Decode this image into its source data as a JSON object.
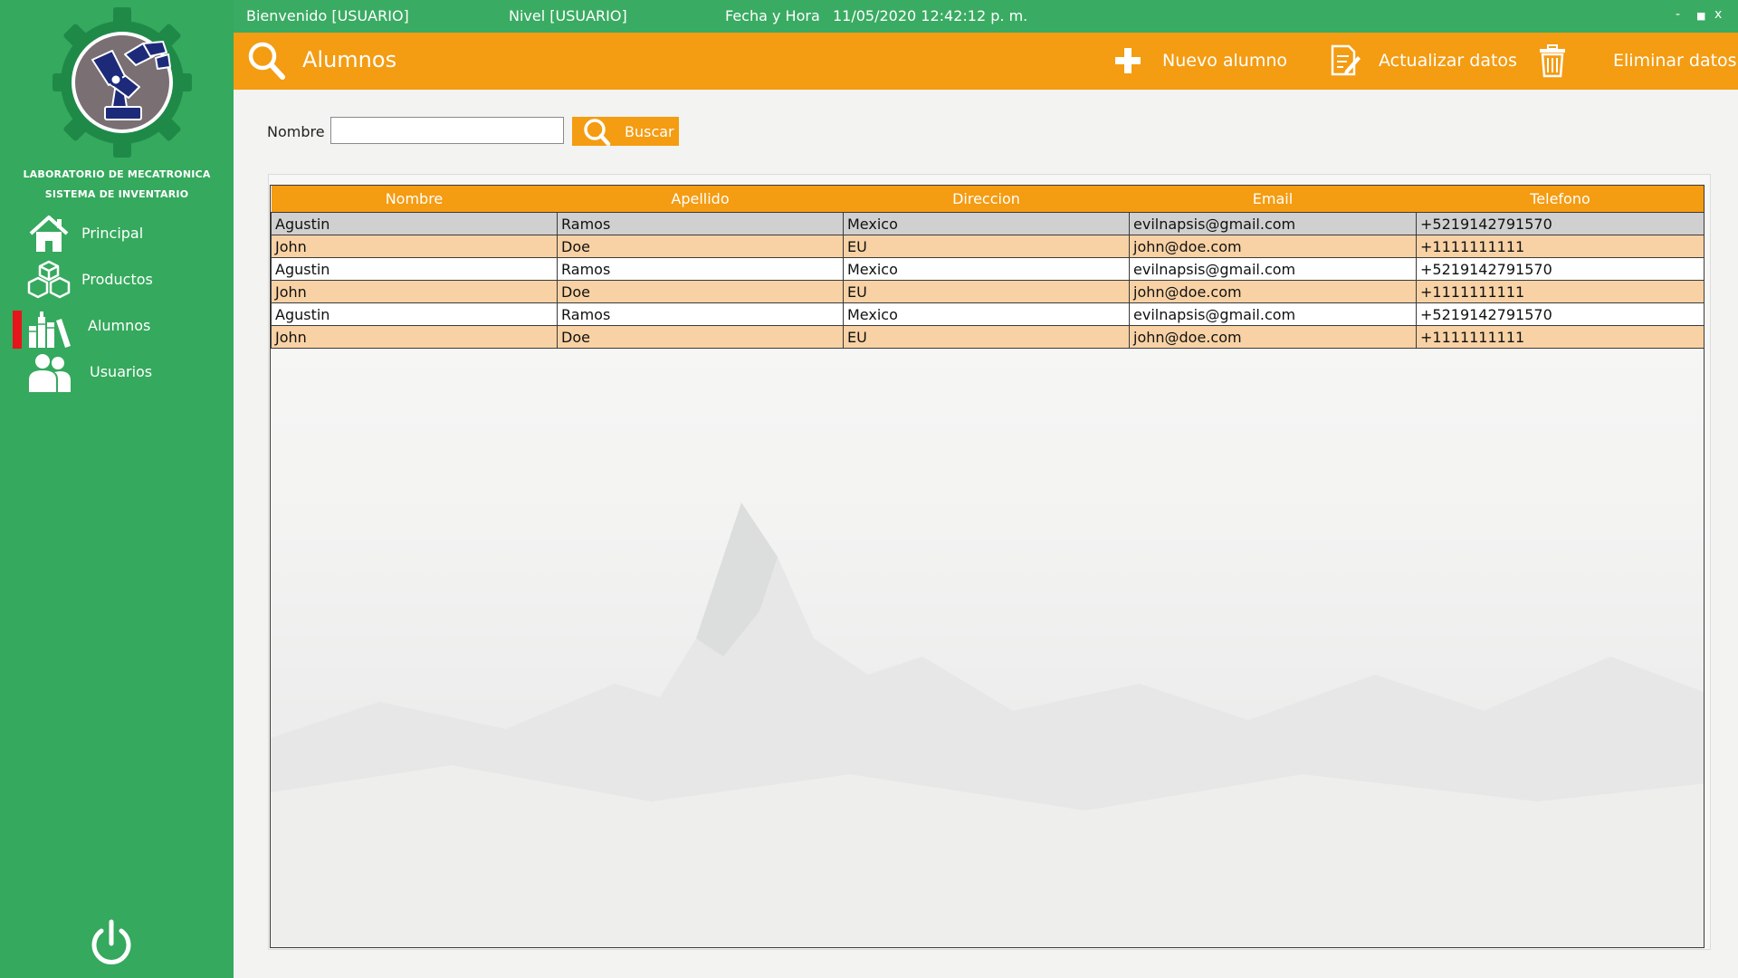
{
  "topbar": {
    "welcome": "Bienvenido [USUARIO]",
    "level": "Nivel [USUARIO]",
    "datetime_label": "Fecha y Hora",
    "datetime_value": "11/05/2020 12:42:12 p. m.",
    "minimize": "-",
    "maximize": "■",
    "close": "x"
  },
  "sidebar": {
    "brand_line1": "LABORATORIO DE MECATRONICA",
    "brand_line2": "SISTEMA DE INVENTARIO",
    "items": [
      {
        "label": "Principal",
        "icon": "home-icon"
      },
      {
        "label": "Productos",
        "icon": "boxes-icon"
      },
      {
        "label": "Alumnos",
        "icon": "students-icon",
        "active": true
      },
      {
        "label": "Usuarios",
        "icon": "users-icon"
      }
    ]
  },
  "header": {
    "title": "Alumnos",
    "new_label": "Nuevo alumno",
    "update_label": "Actualizar datos",
    "delete_label": "Eliminar datos"
  },
  "search": {
    "label": "Nombre",
    "value": "",
    "button_label": "Buscar"
  },
  "table": {
    "columns": [
      "Nombre",
      "Apellido",
      "Direccion",
      "Email",
      "Telefono"
    ],
    "rows": [
      [
        "Agustin",
        "Ramos",
        "Mexico",
        "evilnapsis@gmail.com",
        "+5219142791570"
      ],
      [
        "John",
        "Doe",
        "EU",
        "john@doe.com",
        "+1111111111"
      ],
      [
        "Agustin",
        "Ramos",
        "Mexico",
        "evilnapsis@gmail.com",
        "+5219142791570"
      ],
      [
        "John",
        "Doe",
        "EU",
        "john@doe.com",
        "+1111111111"
      ],
      [
        "Agustin",
        "Ramos",
        "Mexico",
        "evilnapsis@gmail.com",
        "+5219142791570"
      ],
      [
        "John",
        "Doe",
        "EU",
        "john@doe.com",
        "+1111111111"
      ]
    ]
  },
  "colors": {
    "sidebar": "#35a95d",
    "accent": "#f49c12",
    "row_alt": "#f8d2a5",
    "row_selected": "#d0d0d0",
    "active_marker": "#e8141b"
  }
}
